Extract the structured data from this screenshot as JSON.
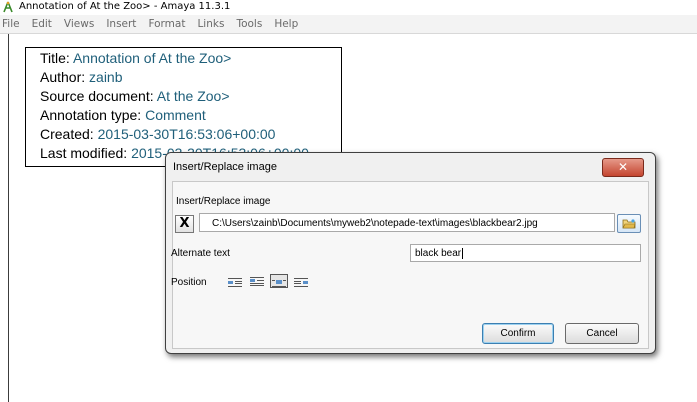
{
  "window": {
    "title": "Annotation of At the Zoo> - Amaya 11.3.1",
    "app_icon": "amaya-icon"
  },
  "menubar": {
    "items": [
      "File",
      "Edit",
      "Views",
      "Insert",
      "Format",
      "Links",
      "Tools",
      "Help"
    ]
  },
  "annotation": {
    "title_label": "Title:",
    "title_value": "Annotation of At the Zoo>",
    "author_label": "Author:",
    "author_value": "zainb",
    "source_label": "Source document:",
    "source_value": "At the Zoo>",
    "type_label": "Annotation type:",
    "type_value": "Comment",
    "created_label": "Created:",
    "created_value": "2015-03-30T16:53:06+00:00",
    "modified_label": "Last modified:",
    "modified_value": "2015-03-30T16:53:06+00:00"
  },
  "dialog": {
    "title": "Insert/Replace image",
    "close_icon": "close-icon",
    "section_label": "Insert/Replace image",
    "clear_button_label": "X",
    "path_value": "C:\\Users\\zainb\\Documents\\myweb2\\notepade-text\\images\\blackbear2.jpg",
    "browse_icon": "folder-browse-icon",
    "alt_label": "Alternate text",
    "alt_value": "black bear",
    "position_label": "Position",
    "position_options": [
      "align-left-icon",
      "align-center-icon",
      "align-inline-icon",
      "align-right-icon"
    ],
    "position_selected": 2,
    "confirm_label": "Confirm",
    "cancel_label": "Cancel"
  },
  "colors": {
    "link_value": "#1f5f7a",
    "close_button": "#c4452f",
    "default_button_border": "#3c7fb1"
  }
}
